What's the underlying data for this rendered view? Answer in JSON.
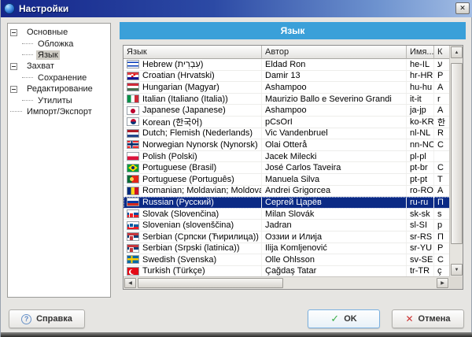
{
  "window": {
    "title": "Настройки"
  },
  "icons": {
    "close": "✕",
    "help": "?",
    "ok_check": "✓",
    "cancel_x": "✕",
    "scroll_up": "▲",
    "scroll_down": "▼",
    "scroll_left": "◀",
    "scroll_right": "▶"
  },
  "sidebar": {
    "items": [
      {
        "label": "Основные",
        "level": 0,
        "expander": true
      },
      {
        "label": "Обложка",
        "level": 1
      },
      {
        "label": "Язык",
        "level": 1,
        "selected": true
      },
      {
        "label": "Захват",
        "level": 0,
        "expander": true
      },
      {
        "label": "Сохранение",
        "level": 1
      },
      {
        "label": "Редактирование",
        "level": 0,
        "expander": true
      },
      {
        "label": "Утилиты",
        "level": 1
      },
      {
        "label": "Импорт/Экспорт",
        "level": 0
      }
    ]
  },
  "panel": {
    "header": "Язык"
  },
  "table": {
    "columns": [
      "Язык",
      "Автор",
      "Имя...",
      "К"
    ],
    "rows": [
      {
        "flag": "il",
        "language": "Hebrew (עִבְרִית)",
        "author": "Eldad Ron",
        "code": "he-IL",
        "extra": "ע"
      },
      {
        "flag": "hr",
        "language": "Croatian (Hrvatski)",
        "author": "Damir 13",
        "code": "hr-HR",
        "extra": "P"
      },
      {
        "flag": "hu",
        "language": "Hungarian (Magyar)",
        "author": "Ashampoo",
        "code": "hu-hu",
        "extra": "A"
      },
      {
        "flag": "it",
        "language": "Italian (Italiano (Italia))",
        "author": "Maurizio Ballo e Severino Grandi",
        "code": "it-it",
        "extra": "r"
      },
      {
        "flag": "jp",
        "language": "Japanese (Japanese)",
        "author": "Ashampoo",
        "code": "ja-jp",
        "extra": "A"
      },
      {
        "flag": "kr",
        "language": "Korean (한국어)",
        "author": "pCsOrI",
        "code": "ko-KR",
        "extra": "한"
      },
      {
        "flag": "nl",
        "language": "Dutch; Flemish (Nederlands)",
        "author": "Vic Vandenbruel",
        "code": "nl-NL",
        "extra": "R"
      },
      {
        "flag": "no",
        "language": "Norwegian Nynorsk (Nynorsk)",
        "author": "Olai Otterå",
        "code": "nn-NO",
        "extra": "C"
      },
      {
        "flag": "pl",
        "language": "Polish (Polski)",
        "author": "Jacek Milecki",
        "code": "pl-pl",
        "extra": ""
      },
      {
        "flag": "br",
        "language": "Portuguese (Brasil)",
        "author": "José Carlos Taveira",
        "code": "pt-br",
        "extra": "C"
      },
      {
        "flag": "pt",
        "language": "Portuguese (Português)",
        "author": "Manuela Silva",
        "code": "pt-pt",
        "extra": "T"
      },
      {
        "flag": "ro",
        "language": "Romanian; Moldavian; Moldovan (Română)",
        "author": "Andrei Grigorcea",
        "code": "ro-RO",
        "extra": "A"
      },
      {
        "flag": "ru",
        "language": "Russian (Русский)",
        "author": "Сергей Царёв",
        "code": "ru-ru",
        "extra": "П",
        "selected": true
      },
      {
        "flag": "sk",
        "language": "Slovak (Slovenčina)",
        "author": "Milan Slovák",
        "code": "sk-sk",
        "extra": "s"
      },
      {
        "flag": "si",
        "language": "Slovenian (slovenščina)",
        "author": "Jadran",
        "code": "sl-SI",
        "extra": "p"
      },
      {
        "flag": "rs",
        "language": "Serbian (Српски (Ћирилица))",
        "author": "Оззии и Илија",
        "code": "sr-RS",
        "extra": "П"
      },
      {
        "flag": "rs",
        "language": "Serbian (Srpski (latinica))",
        "author": "Ilija Komljenović",
        "code": "sr-YU",
        "extra": "P"
      },
      {
        "flag": "se",
        "language": "Swedish (Svenska)",
        "author": "Olle Ohlsson",
        "code": "sv-SE",
        "extra": "C"
      },
      {
        "flag": "tr",
        "language": "Turkish (Türkçe)",
        "author": "Çağdaş Tatar",
        "code": "tr-TR",
        "extra": "ç"
      }
    ],
    "partial_row": {
      "flag": "ua"
    }
  },
  "buttons": {
    "help": "Справка",
    "ok": "OK",
    "cancel": "Отмена"
  },
  "colors": {
    "titlebar_left": "#15268a",
    "titlebar_right": "#a3bde4",
    "panel_header_blue": "#3aa0d9",
    "selection_navy": "#0b2a85",
    "selection_text": "#ffffff",
    "window_bg": "#e6e5e2",
    "ok_border_blue": "#7ab0e0",
    "check_green": "#3db04b",
    "cancel_red": "#cc3333"
  }
}
